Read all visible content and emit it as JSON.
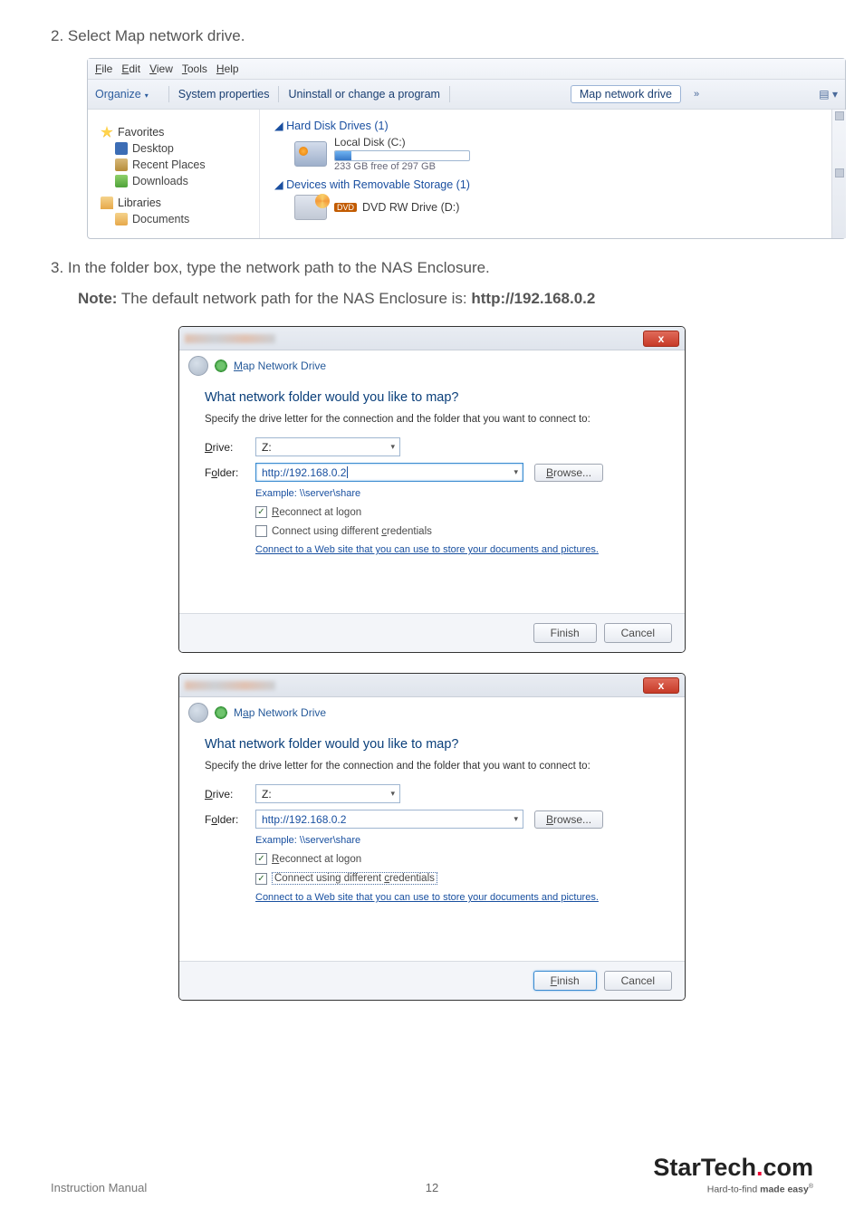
{
  "step2": "2.  Select Map network drive.",
  "explorer": {
    "menubar": [
      "File",
      "Edit",
      "View",
      "Tools",
      "Help"
    ],
    "toolbar": {
      "organize": "Organize",
      "sysprops": "System properties",
      "uninstall": "Uninstall or change a program",
      "mapdrive": "Map network drive",
      "more": "»"
    },
    "sidebar": {
      "favorites": "Favorites",
      "desktop": "Desktop",
      "recent": "Recent Places",
      "downloads": "Downloads",
      "libraries": "Libraries",
      "documents": "Documents"
    },
    "main": {
      "hdd_header": "Hard Disk Drives (1)",
      "disk_name": "Local Disk (C:)",
      "disk_free": "233 GB free of 297 GB",
      "rem_header": "Devices with Removable Storage (1)",
      "dvd_tag": "DVD",
      "dvd_name": "DVD RW Drive (D:)"
    }
  },
  "step3_line": "3.  In the folder box, type the network path to the NAS Enclosure.",
  "note_prefix": "Note:",
  "note_body": " The default network path for the NAS Enclosure is: ",
  "note_url": "http://192.168.0.2",
  "dialog": {
    "crumb": "Map Network Drive",
    "h1": "What network folder would you like to map?",
    "sub": "Specify the drive letter for the connection and the folder that you want to connect to:",
    "drive_lbl": "Drive:",
    "drive_val": "Z:",
    "folder_lbl": "Folder:",
    "folder_val": "http://192.168.0.2",
    "browse": "Browse...",
    "example": "Example: \\\\server\\share",
    "reconnect": "Reconnect at logon",
    "diffcred": "Connect using different credentials",
    "link": "Connect to a Web site that you can use to store your documents and pictures.",
    "finish": "Finish",
    "cancel": "Cancel",
    "close_x": "x"
  },
  "footer": {
    "im": "Instruction Manual",
    "page": "12",
    "brand_a": "StarTech",
    "brand_b": "com",
    "tag_a": "Hard-to-find ",
    "tag_b": "made easy"
  }
}
